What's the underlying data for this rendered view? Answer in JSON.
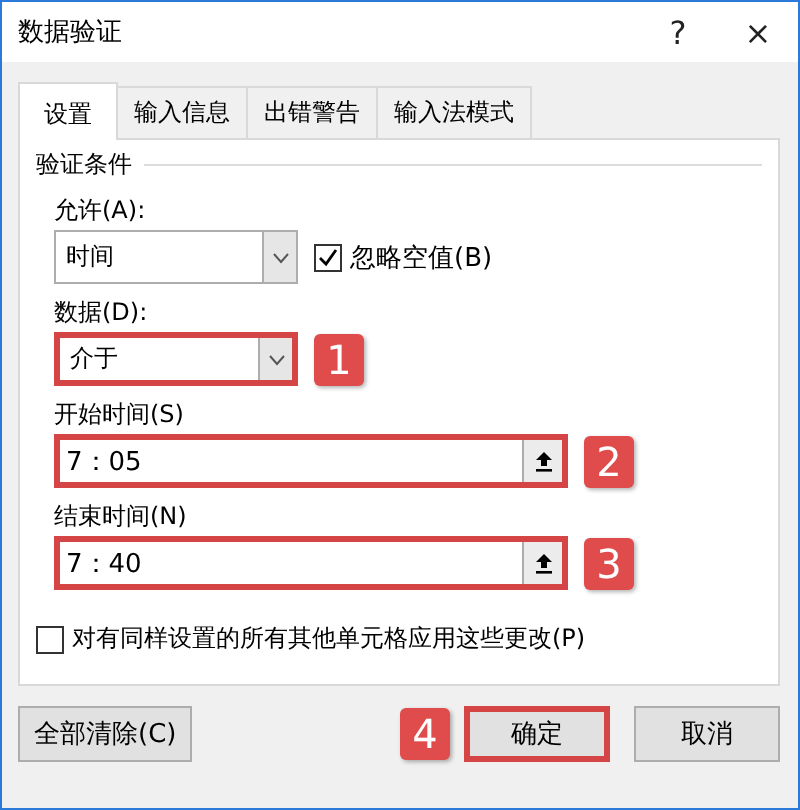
{
  "window": {
    "title": "数据验证",
    "help": "?",
    "close": "×"
  },
  "tabs": [
    {
      "label": "设置",
      "selected": true
    },
    {
      "label": "输入信息",
      "selected": false
    },
    {
      "label": "出错警告",
      "selected": false
    },
    {
      "label": "输入法模式",
      "selected": false
    }
  ],
  "section": "验证条件",
  "allow": {
    "label": "允许(A):",
    "value": "时间"
  },
  "ignore_blank": {
    "label": "忽略空值(B)",
    "checked": true
  },
  "data": {
    "label": "数据(D):",
    "value": "介于",
    "marker": "1"
  },
  "start_time": {
    "label": "开始时间(S)",
    "value": "7：05",
    "marker": "2"
  },
  "end_time": {
    "label": "结束时间(N)",
    "value": "7：40",
    "marker": "3"
  },
  "apply_all": {
    "label": "对有同样设置的所有其他单元格应用这些更改(P)",
    "checked": false
  },
  "buttons": {
    "clear": "全部清除(C)",
    "ok": "确定",
    "ok_marker": "4",
    "cancel": "取消"
  }
}
